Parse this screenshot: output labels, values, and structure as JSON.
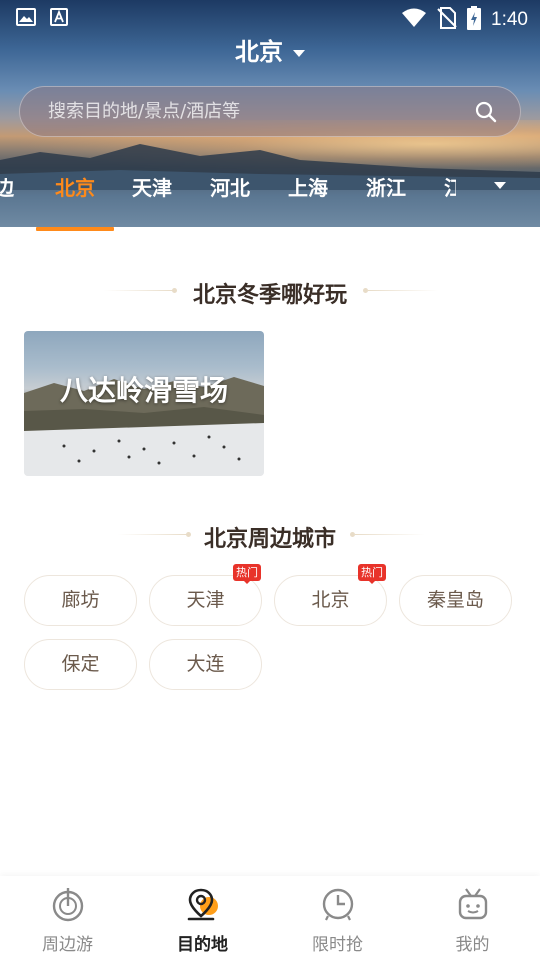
{
  "status_bar": {
    "time": "1:40"
  },
  "header": {
    "city": "北京"
  },
  "search": {
    "placeholder": "搜索目的地/景点/酒店等"
  },
  "tabs": [
    {
      "label": "边"
    },
    {
      "label": "北京"
    },
    {
      "label": "天津"
    },
    {
      "label": "河北"
    },
    {
      "label": "上海"
    },
    {
      "label": "浙江"
    },
    {
      "label": "江"
    }
  ],
  "winter": {
    "title": "北京冬季哪好玩",
    "card_title": "八达岭滑雪场"
  },
  "nearby": {
    "title": "北京周边城市",
    "hot_label": "热门",
    "cities": [
      {
        "name": "廊坊",
        "hot": false
      },
      {
        "name": "天津",
        "hot": true
      },
      {
        "name": "北京",
        "hot": true
      },
      {
        "name": "秦皇岛",
        "hot": false
      },
      {
        "name": "保定",
        "hot": false
      },
      {
        "name": "大连",
        "hot": false
      }
    ]
  },
  "bottom_nav": [
    {
      "label": "周边游",
      "icon": "compass-icon",
      "active": false
    },
    {
      "label": "目的地",
      "icon": "location-pin-icon",
      "active": true
    },
    {
      "label": "限时抢",
      "icon": "clock-icon",
      "active": false
    },
    {
      "label": "我的",
      "icon": "profile-icon",
      "active": false
    }
  ],
  "colors": {
    "accent": "#ff8a1a",
    "hot": "#e8332a",
    "chip_text": "#6b5a4c"
  }
}
